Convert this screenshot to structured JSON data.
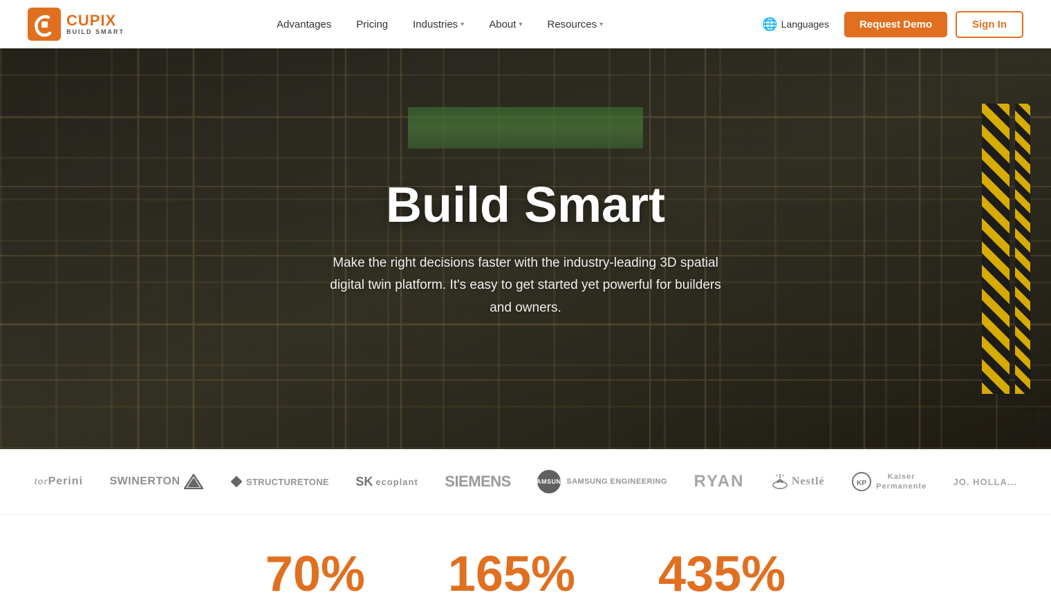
{
  "nav": {
    "logo": {
      "brand": "CUPIX",
      "tagline": "BUILD SMART"
    },
    "links": [
      {
        "id": "advantages",
        "label": "Advantages",
        "hasDropdown": false
      },
      {
        "id": "pricing",
        "label": "Pricing",
        "hasDropdown": false
      },
      {
        "id": "industries",
        "label": "Industries",
        "hasDropdown": true
      },
      {
        "id": "about",
        "label": "About",
        "hasDropdown": true
      },
      {
        "id": "resources",
        "label": "Resources",
        "hasDropdown": true
      }
    ],
    "languages_label": "Languages",
    "request_demo_label": "Request Demo",
    "sign_in_label": "Sign In"
  },
  "hero": {
    "title": "Build Smart",
    "subtitle": "Make the right decisions faster with the industry-leading 3D spatial digital twin platform. It's easy to get started yet powerful for builders and owners."
  },
  "logos": [
    {
      "id": "tor-perini",
      "display": "tor Perini",
      "type": "text"
    },
    {
      "id": "swinerton",
      "display": "SWINERTON",
      "type": "text"
    },
    {
      "id": "structuretone",
      "display": "STRUCTURETONE",
      "type": "text"
    },
    {
      "id": "sk-ecoplant",
      "display": "SK ecoplant",
      "type": "text"
    },
    {
      "id": "siemens",
      "display": "SIEMENS",
      "type": "siemens"
    },
    {
      "id": "samsung-engineering",
      "display": "SAMSUNG ENGINEERING",
      "type": "samsung"
    },
    {
      "id": "ryan",
      "display": "RYAN",
      "type": "text"
    },
    {
      "id": "nestle",
      "display": "Nestlé",
      "type": "text"
    },
    {
      "id": "kaiser-permanente",
      "display": "Kaiser Permanente",
      "type": "text"
    },
    {
      "id": "holland",
      "display": "JO. HOLLA",
      "type": "text"
    }
  ],
  "stats": [
    {
      "id": "stat1",
      "value": "70%"
    },
    {
      "id": "stat2",
      "value": "165%"
    },
    {
      "id": "stat3",
      "value": "435%"
    }
  ],
  "colors": {
    "orange": "#e07020",
    "nav_bg": "#ffffff",
    "hero_overlay": "rgba(20,20,20,0.6)"
  }
}
